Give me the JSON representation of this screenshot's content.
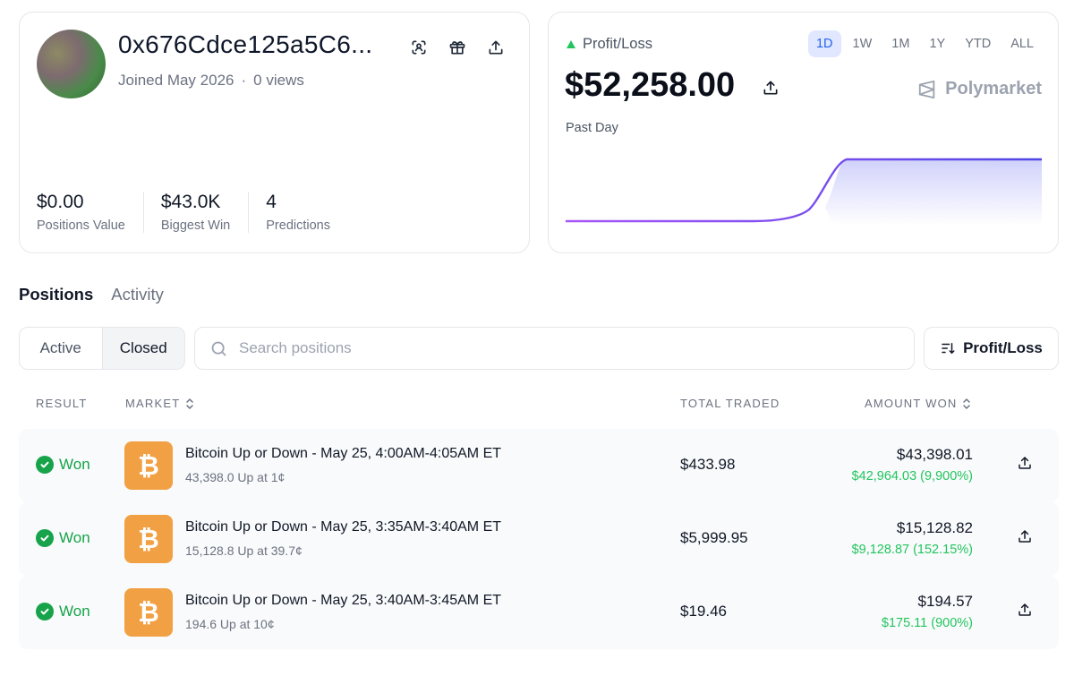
{
  "profile": {
    "wallet": "0x676Cdce125a5C6...",
    "joined": "Joined May 2026",
    "separator": "·",
    "views": "0 views",
    "stats": [
      {
        "value": "$0.00",
        "label": "Positions Value"
      },
      {
        "value": "$43.0K",
        "label": "Biggest Win"
      },
      {
        "value": "4",
        "label": "Predictions"
      }
    ]
  },
  "pnl": {
    "label": "Profit/Loss",
    "value": "$52,258.00",
    "brand": "Polymarket",
    "period": "Past Day",
    "ranges": [
      "1D",
      "1W",
      "1M",
      "1Y",
      "YTD",
      "ALL"
    ],
    "active_range": "1D",
    "trend_color": "#22c55e",
    "line_start_color": "#a855f7",
    "line_end_color": "#4f46e5"
  },
  "tabs": {
    "positions": "Positions",
    "activity": "Activity"
  },
  "filter": {
    "active": "Active",
    "closed": "Closed"
  },
  "search": {
    "placeholder": "Search positions"
  },
  "sort": {
    "label": "Profit/Loss"
  },
  "table": {
    "headers": {
      "result": "RESULT",
      "market": "MARKET",
      "traded": "TOTAL TRADED",
      "won": "AMOUNT WON"
    },
    "rows": [
      {
        "result": "Won",
        "title": "Bitcoin Up or Down - May 25, 4:00AM-4:05AM ET",
        "sub": "43,398.0 Up at 1¢",
        "traded": "$433.98",
        "won": "$43,398.01",
        "gain": "$42,964.03 (9,900%)"
      },
      {
        "result": "Won",
        "title": "Bitcoin Up or Down - May 25, 3:35AM-3:40AM ET",
        "sub": "15,128.8 Up at 39.7¢",
        "traded": "$5,999.95",
        "won": "$15,128.82",
        "gain": "$9,128.87 (152.15%)"
      },
      {
        "result": "Won",
        "title": "Bitcoin Up or Down - May 25, 3:40AM-3:45AM ET",
        "sub": "194.6 Up at 10¢",
        "traded": "$19.46",
        "won": "$194.57",
        "gain": "$175.11 (900%)"
      }
    ]
  },
  "colors": {
    "accent": "#2563eb",
    "win": "#16a34a",
    "gain": "#22c55e",
    "coin": "#f2a044"
  }
}
